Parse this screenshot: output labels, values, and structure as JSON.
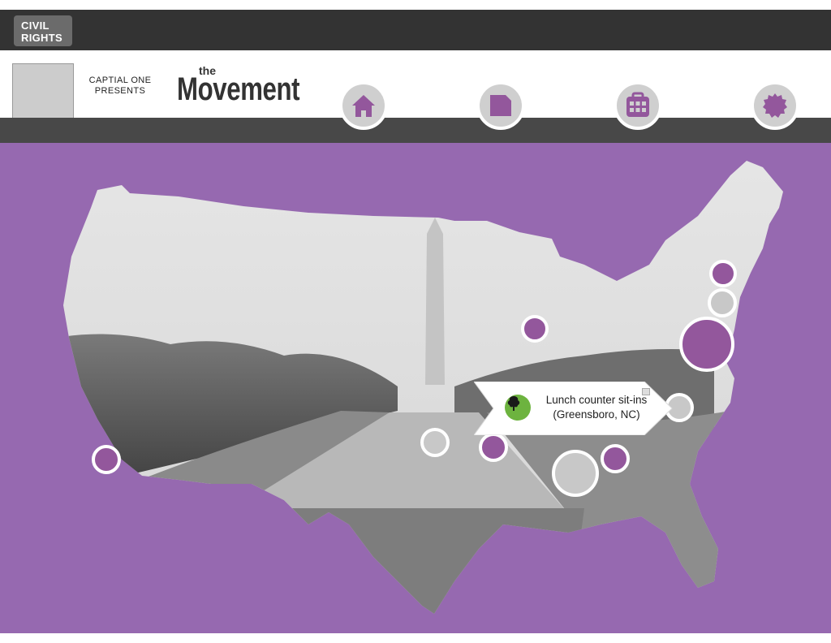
{
  "top_tab": {
    "label": "CIVIL\nRIGHTS"
  },
  "header": {
    "presents_text": "CAPTIAL ONE PRESENTS",
    "brand_small": "the",
    "brand_title": "Movement"
  },
  "nav": [
    {
      "name": "home",
      "icon": "home-icon"
    },
    {
      "name": "notes",
      "icon": "folded-square-icon"
    },
    {
      "name": "calendar",
      "icon": "calendar-icon"
    },
    {
      "name": "badge",
      "icon": "badge-icon"
    }
  ],
  "colors": {
    "accent_purple": "#9669b0",
    "marker_purple": "#93579c",
    "marker_grey": "#c8c8c8",
    "tooltip_icon_green": "#6db33f",
    "dark_bar": "#333333"
  },
  "map": {
    "tooltip": {
      "line1": "Lunch counter sit-ins",
      "line2": "(Greensboro, NC)",
      "icon": "tree-icon"
    }
  }
}
